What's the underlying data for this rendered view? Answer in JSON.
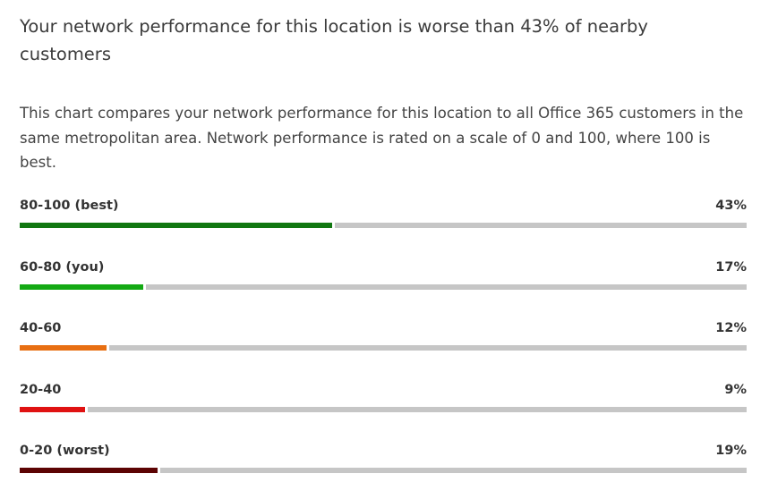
{
  "title": "Your network performance for this location is worse than 43% of nearby customers",
  "description": "This chart compares your network performance for this location to all Office 365 customers in the same metropolitan area. Network performance is rated on a scale of 0 and 100, where 100 is best.",
  "colors": {
    "track": "#c6c6c6",
    "text": "#3b3b3b"
  },
  "chart_data": {
    "type": "bar",
    "orientation": "horizontal",
    "unit": "%",
    "xlim": [
      0,
      100
    ],
    "categories": [
      "80-100 (best)",
      "60-80 (you)",
      "40-60",
      "20-40",
      "0-20 (worst)"
    ],
    "values": [
      43,
      17,
      12,
      9,
      19
    ],
    "value_labels": [
      "43%",
      "17%",
      "12%",
      "9%",
      "19%"
    ],
    "colors": [
      "#117711",
      "#13a913",
      "#e86f12",
      "#e01212",
      "#5c0303"
    ]
  }
}
